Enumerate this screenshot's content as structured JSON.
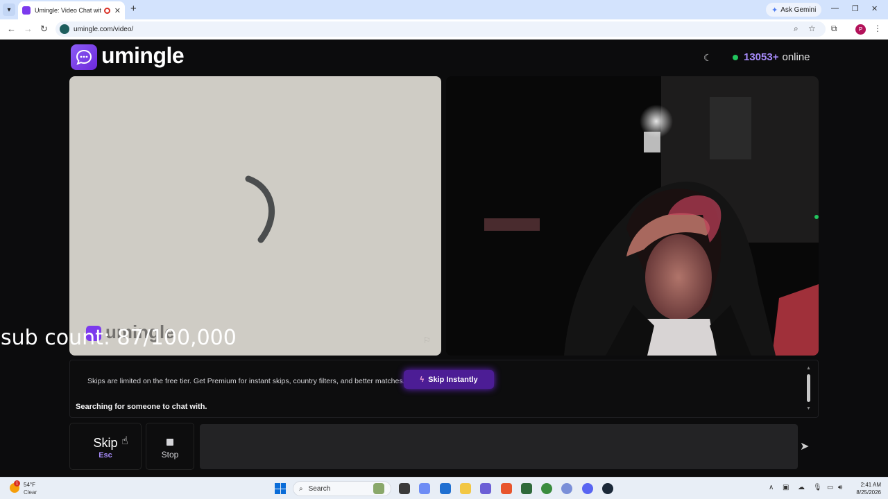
{
  "browser": {
    "tab_title": "Umingle: Video Chat with Str",
    "url": "umingle.com/video/",
    "gemini_label": "Ask Gemini",
    "profile_initial": "P"
  },
  "app": {
    "brand": "umingle",
    "online_count": "13053+",
    "online_label": "online",
    "watermark": "umingle"
  },
  "overlay": {
    "sub_count": "sub count: 87/100,000"
  },
  "chat": {
    "notice": "Skips are limited on the free tier. Get Premium for instant skips, country filters, and better matches.",
    "skip_instantly_label": "Skip Instantly",
    "status": "Searching for someone to chat with."
  },
  "controls": {
    "skip_label": "Skip",
    "skip_shortcut": "Esc",
    "stop_label": "Stop",
    "message_value": "",
    "message_placeholder": ""
  },
  "taskbar": {
    "temperature": "54°F",
    "condition": "Clear",
    "weather_badge": "1",
    "search_label": "Search",
    "time": "2:41 AM",
    "date": "8/25/2026"
  },
  "colors": {
    "accent": "#7c3aed",
    "online_dot": "#22c55e",
    "count_text": "#a78bfa"
  }
}
